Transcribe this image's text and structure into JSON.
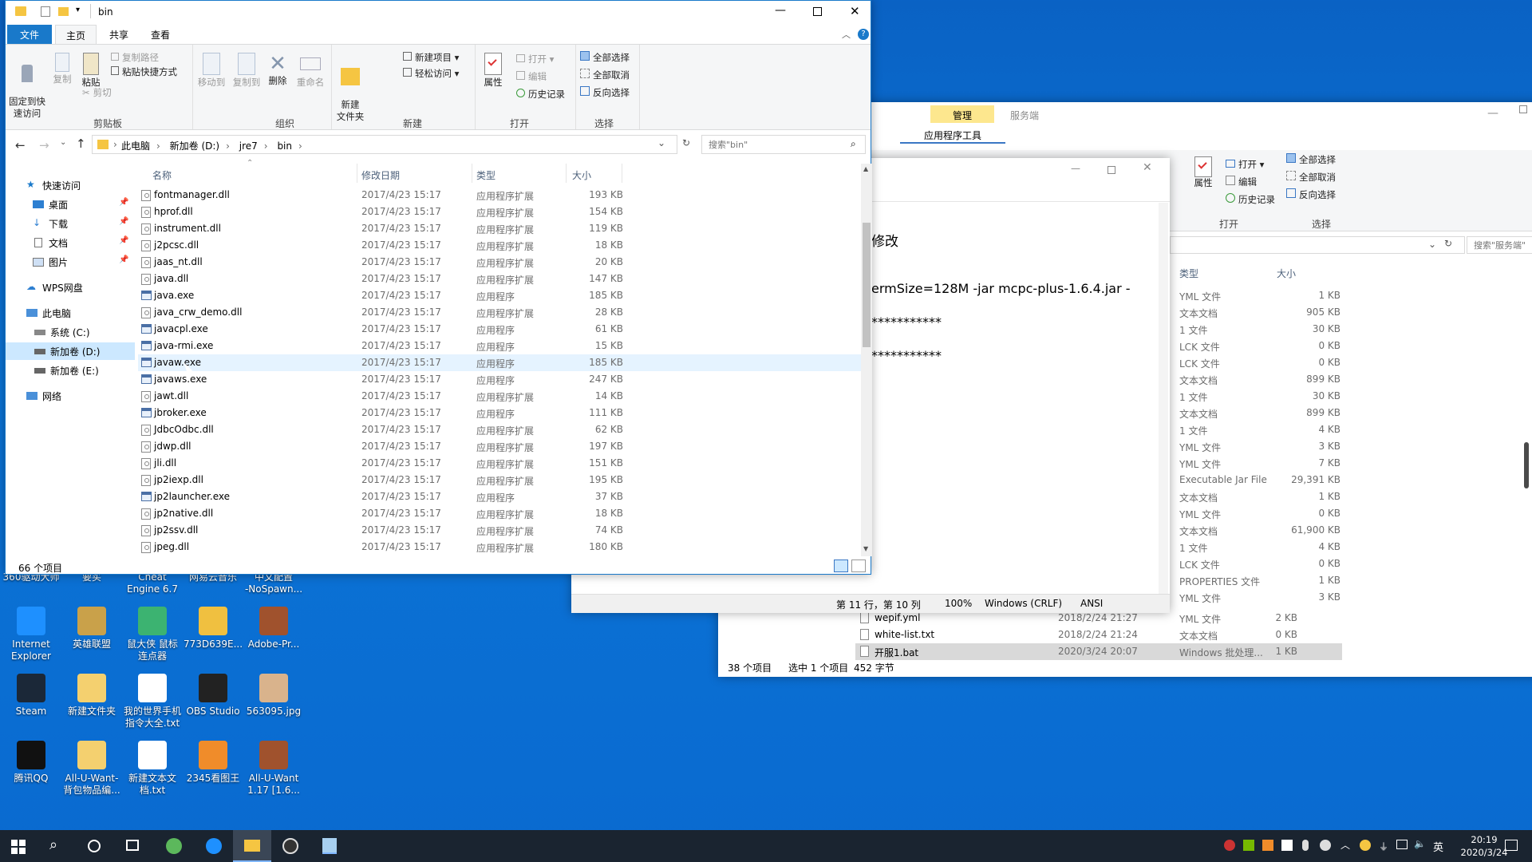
{
  "front_window": {
    "title": "bin",
    "tabs": [
      "文件",
      "主页",
      "共享",
      "查看"
    ],
    "ribbon": {
      "pin": "固定到快\n速访问",
      "copy": "复制",
      "paste": "粘贴",
      "copy_path": "复制路径",
      "paste_shortcut": "粘贴快捷方式",
      "cut": "剪切",
      "move_to": "移动到",
      "copy_to": "复制到",
      "delete": "删除",
      "rename": "重命名",
      "new_item": "新建项目 ▾",
      "easy_access": "轻松访问 ▾",
      "new_folder": "新建\n文件夹",
      "properties": "属性",
      "open": "打开 ▾",
      "edit": "编辑",
      "history": "历史记录",
      "select_all": "全部选择",
      "select_none": "全部取消",
      "invert": "反向选择",
      "groups": [
        "剪贴板",
        "组织",
        "新建",
        "打开",
        "选择"
      ]
    },
    "breadcrumb": [
      "此电脑",
      "新加卷 (D:)",
      "jre7",
      "bin"
    ],
    "search_placeholder": "搜索\"bin\"",
    "columns": [
      "名称",
      "修改日期",
      "类型",
      "大小"
    ],
    "nav": {
      "quick_access": "快速访问",
      "desktop": "桌面",
      "downloads": "下载",
      "documents": "文档",
      "pictures": "图片",
      "wps": "WPS网盘",
      "this_pc": "此电脑",
      "c_drive": "系统 (C:)",
      "d_drive": "新加卷 (D:)",
      "e_drive": "新加卷 (E:)",
      "network": "网络"
    },
    "files": [
      {
        "name": "fontmanager.dll",
        "date": "2017/4/23 15:17",
        "type": "应用程序扩展",
        "size": "193 KB",
        "icon": "dll"
      },
      {
        "name": "hprof.dll",
        "date": "2017/4/23 15:17",
        "type": "应用程序扩展",
        "size": "154 KB",
        "icon": "dll"
      },
      {
        "name": "instrument.dll",
        "date": "2017/4/23 15:17",
        "type": "应用程序扩展",
        "size": "119 KB",
        "icon": "dll"
      },
      {
        "name": "j2pcsc.dll",
        "date": "2017/4/23 15:17",
        "type": "应用程序扩展",
        "size": "18 KB",
        "icon": "dll"
      },
      {
        "name": "jaas_nt.dll",
        "date": "2017/4/23 15:17",
        "type": "应用程序扩展",
        "size": "20 KB",
        "icon": "dll"
      },
      {
        "name": "java.dll",
        "date": "2017/4/23 15:17",
        "type": "应用程序扩展",
        "size": "147 KB",
        "icon": "dll"
      },
      {
        "name": "java.exe",
        "date": "2017/4/23 15:17",
        "type": "应用程序",
        "size": "185 KB",
        "icon": "exe"
      },
      {
        "name": "java_crw_demo.dll",
        "date": "2017/4/23 15:17",
        "type": "应用程序扩展",
        "size": "28 KB",
        "icon": "dll"
      },
      {
        "name": "javacpl.exe",
        "date": "2017/4/23 15:17",
        "type": "应用程序",
        "size": "61 KB",
        "icon": "exe"
      },
      {
        "name": "java-rmi.exe",
        "date": "2017/4/23 15:17",
        "type": "应用程序",
        "size": "15 KB",
        "icon": "exe"
      },
      {
        "name": "javaw.exe",
        "date": "2017/4/23 15:17",
        "type": "应用程序",
        "size": "185 KB",
        "icon": "exe"
      },
      {
        "name": "javaws.exe",
        "date": "2017/4/23 15:17",
        "type": "应用程序",
        "size": "247 KB",
        "icon": "exe"
      },
      {
        "name": "jawt.dll",
        "date": "2017/4/23 15:17",
        "type": "应用程序扩展",
        "size": "14 KB",
        "icon": "dll"
      },
      {
        "name": "jbroker.exe",
        "date": "2017/4/23 15:17",
        "type": "应用程序",
        "size": "111 KB",
        "icon": "exe"
      },
      {
        "name": "JdbcOdbc.dll",
        "date": "2017/4/23 15:17",
        "type": "应用程序扩展",
        "size": "62 KB",
        "icon": "dll"
      },
      {
        "name": "jdwp.dll",
        "date": "2017/4/23 15:17",
        "type": "应用程序扩展",
        "size": "197 KB",
        "icon": "dll"
      },
      {
        "name": "jli.dll",
        "date": "2017/4/23 15:17",
        "type": "应用程序扩展",
        "size": "151 KB",
        "icon": "dll"
      },
      {
        "name": "jp2iexp.dll",
        "date": "2017/4/23 15:17",
        "type": "应用程序扩展",
        "size": "195 KB",
        "icon": "dll"
      },
      {
        "name": "jp2launcher.exe",
        "date": "2017/4/23 15:17",
        "type": "应用程序",
        "size": "37 KB",
        "icon": "exe"
      },
      {
        "name": "jp2native.dll",
        "date": "2017/4/23 15:17",
        "type": "应用程序扩展",
        "size": "18 KB",
        "icon": "dll"
      },
      {
        "name": "jp2ssv.dll",
        "date": "2017/4/23 15:17",
        "type": "应用程序扩展",
        "size": "74 KB",
        "icon": "dll"
      },
      {
        "name": "jpeg.dll",
        "date": "2017/4/23 15:17",
        "type": "应用程序扩展",
        "size": "180 KB",
        "icon": "dll"
      }
    ],
    "status": "66 个项目"
  },
  "back_window": {
    "tab_manage": "管理",
    "tab_title": "服务端",
    "tab_app_tools": "应用程序工具",
    "ribbon": {
      "properties": "属性",
      "open": "打开 ▾",
      "edit": "编辑",
      "history": "历史记录",
      "select_all": "全部选择",
      "select_none": "全部取消",
      "invert": "反向选择",
      "groups": [
        "打开",
        "选择"
      ]
    },
    "search_placeholder": "搜索\"服务端\"",
    "columns": [
      "类型",
      "大小"
    ],
    "rows": [
      {
        "type": "YML 文件",
        "size": "1 KB"
      },
      {
        "type": "文本文档",
        "size": "905 KB"
      },
      {
        "type": "1 文件",
        "size": "30 KB"
      },
      {
        "type": "LCK 文件",
        "size": "0 KB"
      },
      {
        "type": "LCK 文件",
        "size": "0 KB"
      },
      {
        "type": "文本文档",
        "size": "899 KB"
      },
      {
        "type": "1 文件",
        "size": "30 KB"
      },
      {
        "type": "文本文档",
        "size": "899 KB"
      },
      {
        "type": "1 文件",
        "size": "4 KB"
      },
      {
        "type": "YML 文件",
        "size": "3 KB"
      },
      {
        "type": "YML 文件",
        "size": "7 KB"
      },
      {
        "type": "Executable Jar File",
        "size": "29,391 KB"
      },
      {
        "type": "文本文档",
        "size": "1 KB"
      },
      {
        "type": "YML 文件",
        "size": "0 KB"
      },
      {
        "type": "文本文档",
        "size": "61,900 KB"
      },
      {
        "type": "1 文件",
        "size": "4 KB"
      },
      {
        "type": "LCK 文件",
        "size": "0 KB"
      },
      {
        "type": "PROPERTIES 文件",
        "size": "1 KB"
      },
      {
        "type": "YML 文件",
        "size": "3 KB"
      }
    ],
    "bottom_rows": [
      {
        "name": "wepif.yml",
        "date": "2018/2/24 21:27",
        "type": "YML 文件",
        "size": "2 KB"
      },
      {
        "name": "white-list.txt",
        "date": "2018/2/24 21:24",
        "type": "文本文档",
        "size": "0 KB"
      },
      {
        "name": "开服1.bat",
        "date": "2020/3/24 20:07",
        "type": "Windows 批处理...",
        "size": "1 KB"
      }
    ],
    "status_count": "38 个项目",
    "status_sel": "选中 1 个项目",
    "status_bytes": "452 字节"
  },
  "notepad": {
    "lines": [
      "修改",
      "ermSize=128M -jar mcpc-plus-1.6.4.jar -",
      "***********",
      "***********"
    ],
    "status_pos": "第 11 行，第 10 列",
    "status_zoom": "100%",
    "status_eol": "Windows (CRLF)",
    "status_enc": "ANSI"
  },
  "desktop_icons": [
    {
      "label": "Internet\nExplorer",
      "color": "#1e90ff"
    },
    {
      "label": "英雄联盟",
      "color": "#c9a14a"
    },
    {
      "label": "鼠大侠 鼠标\n连点器",
      "color": "#3cb371"
    },
    {
      "label": "773D639E...",
      "color": "#f0c040"
    },
    {
      "label": "Adobe-Pr...",
      "color": "#a0522d"
    },
    {
      "label": "Steam",
      "color": "#1b2838"
    },
    {
      "label": "新建文件夹",
      "color": "#f4d06f"
    },
    {
      "label": "我的世界手机\n指令大全.txt",
      "color": "#ffffff"
    },
    {
      "label": "OBS Studio",
      "color": "#222222"
    },
    {
      "label": "563095.jpg",
      "color": "#d9b38c"
    },
    {
      "label": "腾讯QQ",
      "color": "#111111"
    },
    {
      "label": "All-U-Want-\n背包物品编...",
      "color": "#f4d06f"
    },
    {
      "label": "新建文本文\n档.txt",
      "color": "#ffffff"
    },
    {
      "label": "2345看图王",
      "color": "#f08c2a"
    },
    {
      "label": "All-U-Want\n1.17 [1.6...",
      "color": "#a0522d"
    }
  ],
  "desktop_partial_labels": [
    "360驱动大师",
    "要买",
    "Cheat\nEngine 6.7",
    "网易云音乐",
    "中文配置\n-NoSpawn..."
  ],
  "taskbar": {
    "ime": "英",
    "time": "20:19",
    "date": "2020/3/24"
  }
}
